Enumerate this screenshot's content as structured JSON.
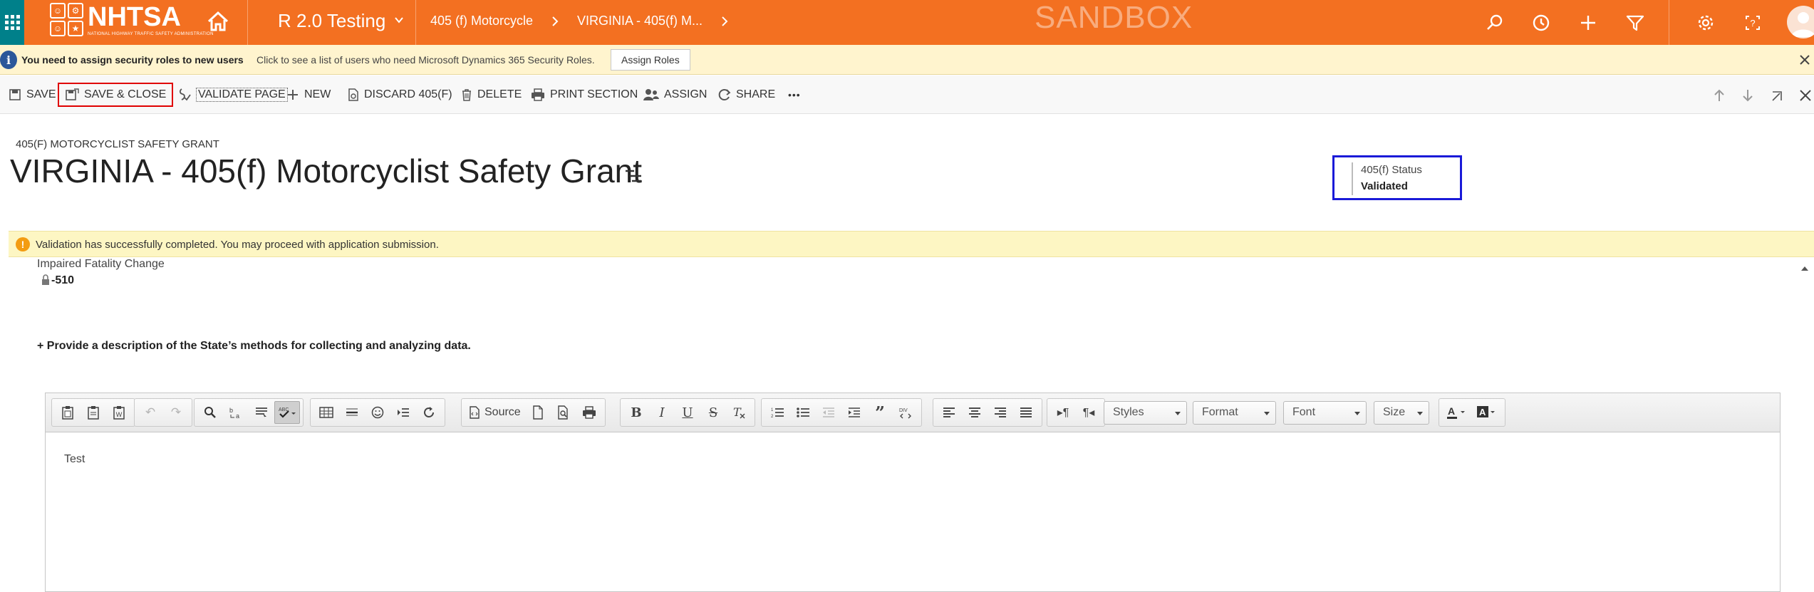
{
  "topbar": {
    "logo_word": "NHTSA",
    "logo_sub": "NATIONAL HIGHWAY TRAFFIC SAFETY ADMINISTRATION",
    "app_name": "R 2.0 Testing",
    "breadcrumbs": [
      "405 (f) Motorcycle",
      "VIRGINIA - 405(f) M..."
    ],
    "environment": "SANDBOX"
  },
  "notification": {
    "title": "You need to assign security roles to new users",
    "message": "Click to see a list of users who need Microsoft Dynamics 365 Security Roles.",
    "button": "Assign Roles"
  },
  "commands": {
    "save": "SAVE",
    "save_close": "SAVE & CLOSE",
    "validate": "VALIDATE PAGE",
    "new": "NEW",
    "discard": "DISCARD 405(F)",
    "delete": "DELETE",
    "print": "PRINT SECTION",
    "assign": "ASSIGN",
    "share": "SHARE",
    "more": "•••"
  },
  "header": {
    "entity": "405(F) MOTORCYCLIST SAFETY GRANT",
    "title": "VIRGINIA - 405(f) Motorcyclist Safety Grant",
    "status_label": "405(f) Status",
    "status_value": "Validated"
  },
  "validation_message": "Validation has successfully completed. You may proceed with application submission.",
  "form": {
    "field_label": "Impaired Fatality Change",
    "field_value": "-510",
    "question": "+ Provide a description of the State’s methods for collecting and analyzing data."
  },
  "editor": {
    "source_label": "Source",
    "styles": "Styles",
    "format": "Format",
    "font": "Font",
    "size": "Size",
    "content": "Test"
  },
  "colors": {
    "brand_orange": "#f37021",
    "waffle_teal": "#00808a",
    "notification_bg": "#fff4ce",
    "validation_bg": "#fdf6c3",
    "highlight_red": "#e00000",
    "highlight_blue": "#1a1ad8"
  }
}
